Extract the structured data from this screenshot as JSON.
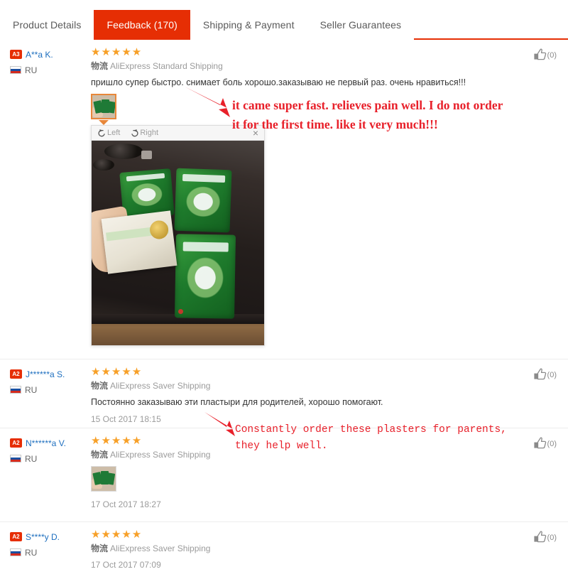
{
  "tabs": [
    {
      "label": "Product Details",
      "active": false
    },
    {
      "label": "Feedback (170)",
      "active": true
    },
    {
      "label": "Shipping & Payment",
      "active": false
    },
    {
      "label": "Seller Guarantees",
      "active": false
    }
  ],
  "colors": {
    "accent": "#e62e04",
    "star": "#f7a028",
    "username": "#1e6fbf",
    "annotation": "#e8202a",
    "muted": "#9b9b9b"
  },
  "icons": {
    "logistics_cn": "物流",
    "rotate_left": "Left",
    "rotate_right": "Right",
    "close": "×",
    "stars": "★★★★★"
  },
  "viewer": {
    "rotate_left_label": "Left",
    "rotate_right_label": "Right",
    "close_label": "×",
    "photo_alt": "green tiger balm plaster packets held over a dark table"
  },
  "annotations": [
    {
      "id": "annotation-review-1",
      "line1": "it came super fast. relieves pain well. I do not order",
      "line2": "it for the first time. like it very much!!!"
    },
    {
      "id": "annotation-review-2",
      "line1": "Constantly order these plasters for parents,",
      "line2": "they help well."
    }
  ],
  "reviews": [
    {
      "badge": "A3",
      "username": "A**a K.",
      "country": "RU",
      "rating": "★★★★★",
      "shipping": "AliExpress Standard Shipping",
      "text": "пришло супер быстро. снимает боль хорошо.заказываю не первый раз. очень нравиться!!!",
      "date": "",
      "helpful_count": "(0)",
      "has_thumbnail": true,
      "thumbnail_selected": true
    },
    {
      "badge": "A2",
      "username": "J******a S.",
      "country": "RU",
      "rating": "★★★★★",
      "shipping": "AliExpress Saver Shipping",
      "text": "Постоянно заказываю эти пластыри для родителей, хорошо помогают.",
      "date": "15 Oct 2017 18:15",
      "helpful_count": "(0)",
      "has_thumbnail": false,
      "thumbnail_selected": false
    },
    {
      "badge": "A2",
      "username": "N******a V.",
      "country": "RU",
      "rating": "★★★★★",
      "shipping": "AliExpress Saver Shipping",
      "text": "",
      "date": "17 Oct 2017 18:27",
      "helpful_count": "(0)",
      "has_thumbnail": true,
      "thumbnail_selected": false
    },
    {
      "badge": "A2",
      "username": "S****y D.",
      "country": "RU",
      "rating": "★★★★★",
      "shipping": "AliExpress Saver Shipping",
      "text": "",
      "date": "17 Oct 2017 07:09",
      "helpful_count": "(0)",
      "has_thumbnail": false,
      "thumbnail_selected": false
    }
  ]
}
